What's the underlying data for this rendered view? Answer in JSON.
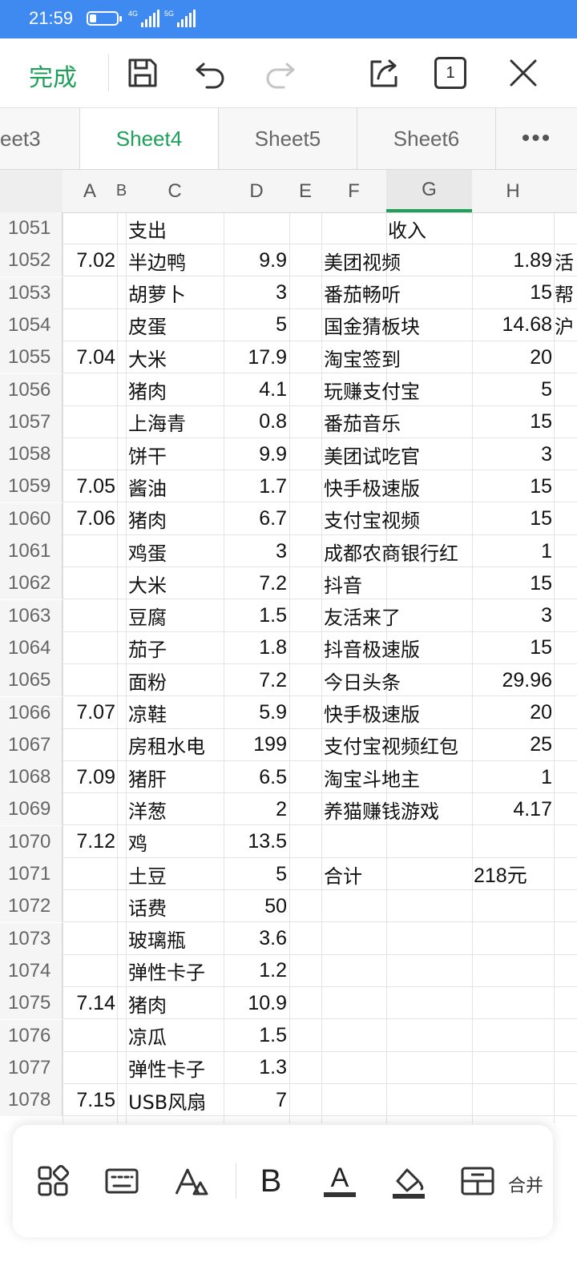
{
  "status_bar": {
    "time": "21:59",
    "signal_1_label": "4G",
    "signal_2_label": "5G"
  },
  "toolbar": {
    "done_label": "完成",
    "window_count": "1",
    "icons": [
      "save-icon",
      "undo-icon",
      "redo-icon",
      "share-icon",
      "window-count-icon",
      "close-icon"
    ]
  },
  "sheet_tabs": {
    "tabs": [
      "eet3",
      "Sheet4",
      "Sheet5",
      "Sheet6"
    ],
    "active": "Sheet4",
    "more": "•••"
  },
  "columns": [
    "A",
    "B",
    "C",
    "D",
    "E",
    "F",
    "G",
    "H"
  ],
  "selected_column": "G",
  "rows": [
    {
      "n": "1051",
      "a": "",
      "c": "支出",
      "d": "",
      "f": "",
      "g": "收入",
      "h": "",
      "i": ""
    },
    {
      "n": "1052",
      "a": "7.02",
      "c": "半边鸭",
      "d": "9.9",
      "f": "美团视频",
      "g": "",
      "h": "1.89",
      "i": "活"
    },
    {
      "n": "1053",
      "a": "",
      "c": "胡萝卜",
      "d": "3",
      "f": "番茄畅听",
      "g": "",
      "h": "15",
      "i": "帮"
    },
    {
      "n": "1054",
      "a": "",
      "c": "皮蛋",
      "d": "5",
      "f": "国金猜板块",
      "g": "",
      "h": "14.68",
      "i": "沪"
    },
    {
      "n": "1055",
      "a": "7.04",
      "c": "大米",
      "d": "17.9",
      "f": "淘宝签到",
      "g": "",
      "h": "20",
      "i": ""
    },
    {
      "n": "1056",
      "a": "",
      "c": "猪肉",
      "d": "4.1",
      "f": "玩赚支付宝",
      "g": "",
      "h": "5",
      "i": ""
    },
    {
      "n": "1057",
      "a": "",
      "c": "上海青",
      "d": "0.8",
      "f": "番茄音乐",
      "g": "",
      "h": "15",
      "i": ""
    },
    {
      "n": "1058",
      "a": "",
      "c": "饼干",
      "d": "9.9",
      "f": "美团试吃官",
      "g": "",
      "h": "3",
      "i": ""
    },
    {
      "n": "1059",
      "a": "7.05",
      "c": "酱油",
      "d": "1.7",
      "f": "快手极速版",
      "g": "",
      "h": "15",
      "i": ""
    },
    {
      "n": "1060",
      "a": "7.06",
      "c": "猪肉",
      "d": "6.7",
      "f": "支付宝视频",
      "g": "",
      "h": "15",
      "i": ""
    },
    {
      "n": "1061",
      "a": "",
      "c": "鸡蛋",
      "d": "3",
      "f": "成都农商银行红",
      "g": "",
      "h": "1",
      "i": ""
    },
    {
      "n": "1062",
      "a": "",
      "c": "大米",
      "d": "7.2",
      "f": "抖音",
      "g": "",
      "h": "15",
      "i": ""
    },
    {
      "n": "1063",
      "a": "",
      "c": "豆腐",
      "d": "1.5",
      "f": "友活来了",
      "g": "",
      "h": "3",
      "i": ""
    },
    {
      "n": "1064",
      "a": "",
      "c": "茄子",
      "d": "1.8",
      "f": "抖音极速版",
      "g": "",
      "h": "15",
      "i": ""
    },
    {
      "n": "1065",
      "a": "",
      "c": "面粉",
      "d": "7.2",
      "f": "今日头条",
      "g": "",
      "h": "29.96",
      "i": ""
    },
    {
      "n": "1066",
      "a": "7.07",
      "c": "凉鞋",
      "d": "5.9",
      "f": "快手极速版",
      "g": "",
      "h": "20",
      "i": ""
    },
    {
      "n": "1067",
      "a": "",
      "c": "房租水电",
      "d": "199",
      "f": "支付宝视频红包",
      "g": "",
      "h": "25",
      "i": ""
    },
    {
      "n": "1068",
      "a": "7.09",
      "c": "猪肝",
      "d": "6.5",
      "f": "淘宝斗地主",
      "g": "",
      "h": "1",
      "i": ""
    },
    {
      "n": "1069",
      "a": "",
      "c": "洋葱",
      "d": "2",
      "f": "养猫赚钱游戏",
      "g": "",
      "h": "4.17",
      "i": ""
    },
    {
      "n": "1070",
      "a": "7.12",
      "c": "鸡",
      "d": "13.5",
      "f": "",
      "g": "",
      "h": "",
      "i": ""
    },
    {
      "n": "1071",
      "a": "",
      "c": "土豆",
      "d": "5",
      "f": "合计",
      "g": "",
      "h": "",
      "i": "",
      "total": "218元"
    },
    {
      "n": "1072",
      "a": "",
      "c": "话费",
      "d": "50",
      "f": "",
      "g": "",
      "h": "",
      "i": ""
    },
    {
      "n": "1073",
      "a": "",
      "c": "玻璃瓶",
      "d": "3.6",
      "f": "",
      "g": "",
      "h": "",
      "i": ""
    },
    {
      "n": "1074",
      "a": "",
      "c": "弹性卡子",
      "d": "1.2",
      "f": "",
      "g": "",
      "h": "",
      "i": ""
    },
    {
      "n": "1075",
      "a": "7.14",
      "c": "猪肉",
      "d": "10.9",
      "f": "",
      "g": "",
      "h": "",
      "i": ""
    },
    {
      "n": "1076",
      "a": "",
      "c": "凉瓜",
      "d": "1.5",
      "f": "",
      "g": "",
      "h": "",
      "i": ""
    },
    {
      "n": "1077",
      "a": "",
      "c": "弹性卡子",
      "d": "1.3",
      "f": "",
      "g": "",
      "h": "",
      "i": ""
    },
    {
      "n": "1078",
      "a": "7.15",
      "c": "USB风扇",
      "d": "7",
      "f": "",
      "g": "",
      "h": "",
      "i": ""
    }
  ],
  "bottom_bar": {
    "icons": [
      "apps-grid-icon",
      "keyboard-icon",
      "clear-format-icon",
      "bold-icon",
      "font-color-icon",
      "fill-color-icon",
      "merge-cells-icon"
    ],
    "bold_glyph": "B",
    "font_color_glyph": "A",
    "merge_label": "合并",
    "accent_color": "#1ea05a"
  },
  "colors": {
    "status_bar": "#3f8af0",
    "accent": "#1ea05a",
    "disabled_icon": "#c4c4c4"
  }
}
